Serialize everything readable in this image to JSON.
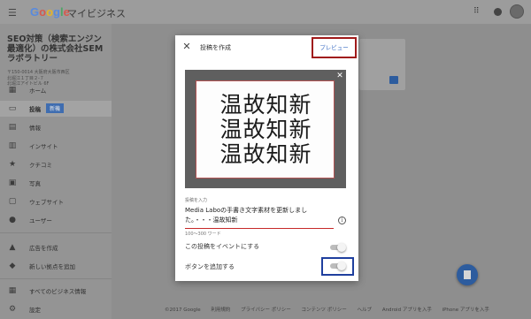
{
  "app": {
    "logo_text": "Google",
    "product_name": "マイビジネス",
    "logo_colors": [
      "#4285F4",
      "#EA4335",
      "#FBBC05",
      "#4285F4",
      "#34A853",
      "#EA4335"
    ]
  },
  "sidebar": {
    "business_name": "SEO対策（検索エンジン最適化）の株式会社SEMラボラトリー",
    "address_lines": [
      "〒150-0014 大阪府大阪市西区",
      "北堀江１丁目２-７",
      "北堀江アイトビル 6F"
    ],
    "items": [
      {
        "label": "ホーム",
        "icon": "home-icon"
      },
      {
        "label": "投稿",
        "icon": "posts-icon",
        "badge": "新機",
        "active": true
      },
      {
        "label": "情報",
        "icon": "info-card-icon"
      },
      {
        "label": "インサイト",
        "icon": "insights-icon"
      },
      {
        "label": "クチコミ",
        "icon": "star-icon"
      },
      {
        "label": "写真",
        "icon": "photo-icon"
      },
      {
        "label": "ウェブサイト",
        "icon": "website-icon"
      },
      {
        "label": "ユーザー",
        "icon": "users-icon"
      },
      {
        "label": "広告を作成",
        "icon": "ads-icon"
      },
      {
        "label": "新しい拠点を追加",
        "icon": "location-icon"
      },
      {
        "label": "すべてのビジネス情報",
        "icon": "business-icon"
      },
      {
        "label": "設定",
        "icon": "gear-icon"
      }
    ]
  },
  "footer": {
    "items": [
      "©2017 Google",
      "利用規約",
      "プライバシー ポリシー",
      "コンテンツ ポリシー",
      "ヘルプ",
      "Android アプリを入手",
      "iPhone アプリを入手"
    ]
  },
  "modal": {
    "title": "投稿を作成",
    "preview_label": "プレビュー",
    "photo": {
      "kanji_lines": [
        "温故知新",
        "温故知新",
        "温故知新"
      ]
    },
    "input": {
      "label": "投稿を入力",
      "text": "Media Laboの手書き文字素材を更新しました。・・・温故知新",
      "word_hint": "100〜300 ワード"
    },
    "event_toggle_label": "この投稿をイベントにする",
    "event_toggle_on": false,
    "button_toggle_label": "ボタンを追加する",
    "button_toggle_on": false
  },
  "colors": {
    "accent": "#3f6fc4",
    "highlight_red": "#a01a1a",
    "highlight_blue": "#1f3f9e",
    "fab": "#2d5c9e"
  }
}
